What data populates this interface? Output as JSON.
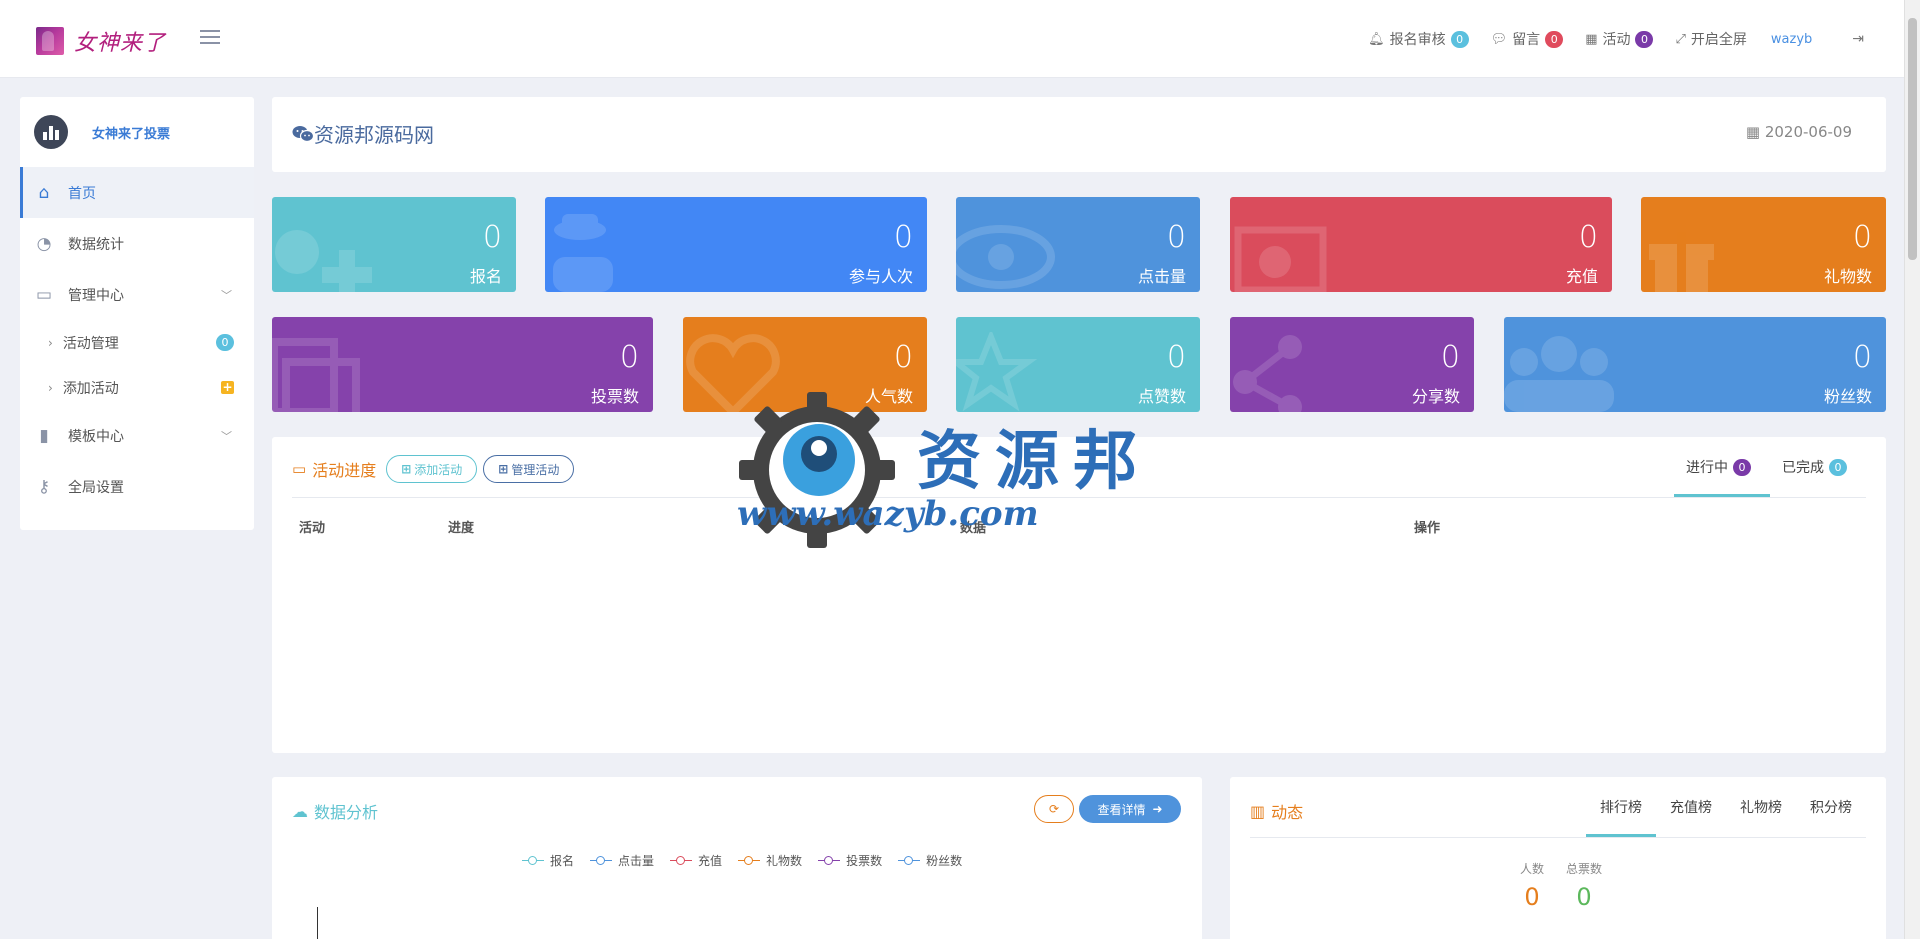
{
  "header": {
    "logo_text": "女神来了",
    "items": [
      {
        "label": "报名审核",
        "badge": "0",
        "icon": "bell-icon"
      },
      {
        "label": "留言",
        "badge": "0",
        "icon": "comment-icon"
      },
      {
        "label": "活动",
        "badge": "0",
        "icon": "calendar-icon"
      },
      {
        "label": "开启全屏",
        "icon": "fullscreen-icon"
      }
    ],
    "user": "wazyb"
  },
  "sidebar": {
    "brand": "女神来了投票",
    "items": [
      {
        "label": "首页",
        "icon": "home-icon"
      },
      {
        "label": "数据统计",
        "icon": "pie-chart-icon"
      },
      {
        "label": "管理中心",
        "icon": "monitor-icon"
      },
      {
        "label": "活动管理",
        "badge": "0"
      },
      {
        "label": "添加活动",
        "badge": "+"
      },
      {
        "label": "模板中心",
        "icon": "file-icon"
      },
      {
        "label": "全局设置",
        "icon": "key-icon"
      }
    ]
  },
  "title_panel": {
    "title": "资源邦源码网",
    "date": "2020-06-09",
    "icon": "wechat-icon"
  },
  "stats": [
    {
      "value": "0",
      "label": "报名"
    },
    {
      "value": "0",
      "label": "参与人次"
    },
    {
      "value": "0",
      "label": "点击量"
    },
    {
      "value": "0",
      "label": "充值"
    },
    {
      "value": "0",
      "label": "礼物数"
    },
    {
      "value": "0",
      "label": "投票数"
    },
    {
      "value": "0",
      "label": "人气数"
    },
    {
      "value": "0",
      "label": "点赞数"
    },
    {
      "value": "0",
      "label": "分享数"
    },
    {
      "value": "0",
      "label": "粉丝数"
    }
  ],
  "colors": {
    "teal": "#5fc3d0",
    "blue": "#4287f5",
    "sky": "#4f93dc",
    "red": "#da4c5c",
    "orange": "#e57e1d",
    "purple": "#8542ab"
  },
  "activity": {
    "title": "活动进度",
    "add_btn": "添加活动",
    "manage_btn": "管理活动",
    "tabs": [
      {
        "label": "进行中",
        "badge": "0"
      },
      {
        "label": "已完成",
        "badge": "0"
      }
    ],
    "columns": [
      "活动",
      "进度",
      "数据",
      "操作"
    ]
  },
  "analysis": {
    "title": "数据分析",
    "detail_btn": "查看详情",
    "legend": [
      "报名",
      "点击量",
      "充值",
      "礼物数",
      "投票数",
      "粉丝数"
    ]
  },
  "dynamic": {
    "title": "动态",
    "tabs": [
      "排行榜",
      "充值榜",
      "礼物榜",
      "积分榜"
    ],
    "stats": [
      {
        "label": "人数",
        "value": "0"
      },
      {
        "label": "总票数",
        "value": "0"
      }
    ]
  },
  "watermark": {
    "title": "资源邦",
    "url": "www.wazyb.com"
  }
}
